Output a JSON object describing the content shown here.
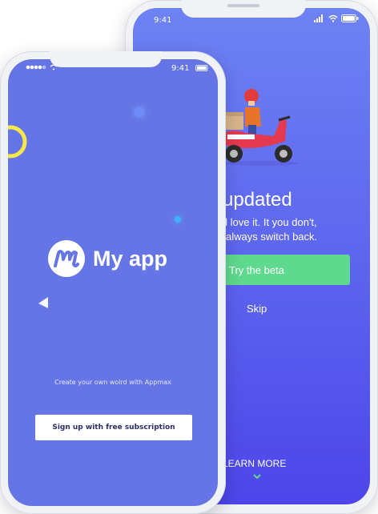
{
  "back_phone": {
    "status_time": "9:41",
    "title": "updated",
    "description_line1": "will love it. It you don't,",
    "description_line2": "always switch back.",
    "try_beta_label": "Try the beta",
    "skip_label": "Skip",
    "learn_more_label": "LEARN MORE"
  },
  "front_phone": {
    "status_time": "9:41",
    "app_name": "My app",
    "tagline": "Create your own wolrd with Appmax",
    "signup_label": "Sign up with free subscription"
  },
  "colors": {
    "front_bg": "#6675e6",
    "back_gradient_top": "#6d82f3",
    "back_gradient_bottom": "#4d45ea",
    "beta_button": "#5fd98e",
    "accent_yellow": "#f7e84a"
  },
  "icons": [
    "signal-icon",
    "wifi-icon",
    "battery-icon",
    "scooter-illustration",
    "app-logo-icon",
    "chevron-down-icon",
    "play-triangle-icon"
  ]
}
